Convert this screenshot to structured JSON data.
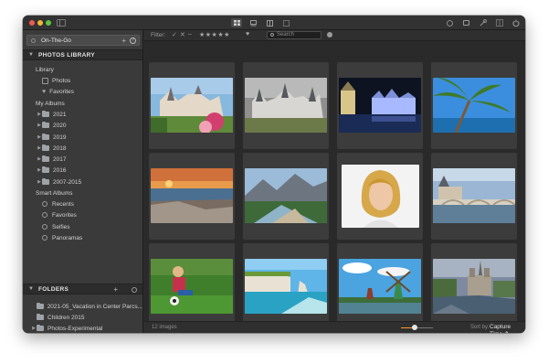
{
  "toolbar": {
    "center_buttons": [
      "grid-view-icon",
      "filmstrip-view-icon",
      "side-by-side-view-icon",
      "single-view-icon"
    ],
    "right_buttons": [
      "info-icon",
      "adjust-icon",
      "tools-icon",
      "layout-icon",
      "power-icon"
    ]
  },
  "sidebar": {
    "project": "On-The-Go",
    "photos_library_title": "PHOTOS LIBRARY",
    "library_label": "Library",
    "library_items": [
      "Photos",
      "Favorites"
    ],
    "my_albums_label": "My Albums",
    "albums": [
      "2021",
      "2020",
      "2019",
      "2018",
      "2017",
      "2016",
      "2007-2015"
    ],
    "smart_albums_label": "Smart Albums",
    "smart_albums": [
      "Recents",
      "Favorites",
      "Selfies",
      "Panoramas"
    ],
    "folders_title": "FOLDERS",
    "folders": [
      "2021-05_Vacation in Center Parcs...",
      "Children 2015",
      "Photos-Experimental"
    ]
  },
  "filter": {
    "label": "Filter:",
    "check": "✓",
    "x": "✕",
    "dash": "–",
    "stars": "★★★★★",
    "heart": "♥",
    "search_placeholder": "Search"
  },
  "photos": [
    "chateau-garden",
    "chateau-cloudy",
    "chateau-night",
    "palm-tree",
    "sunset-beach",
    "mountain-river",
    "portrait-woman",
    "bridge-chateau",
    "child-soccer",
    "cliff-bay",
    "windmills",
    "cathedral-river"
  ],
  "status": {
    "count": "12 images",
    "thumbnail_size_fraction": 0.35,
    "sort_label": "Sort by:",
    "sort_value": "Capture Time ⇕",
    "sort_dir": "AZ"
  }
}
